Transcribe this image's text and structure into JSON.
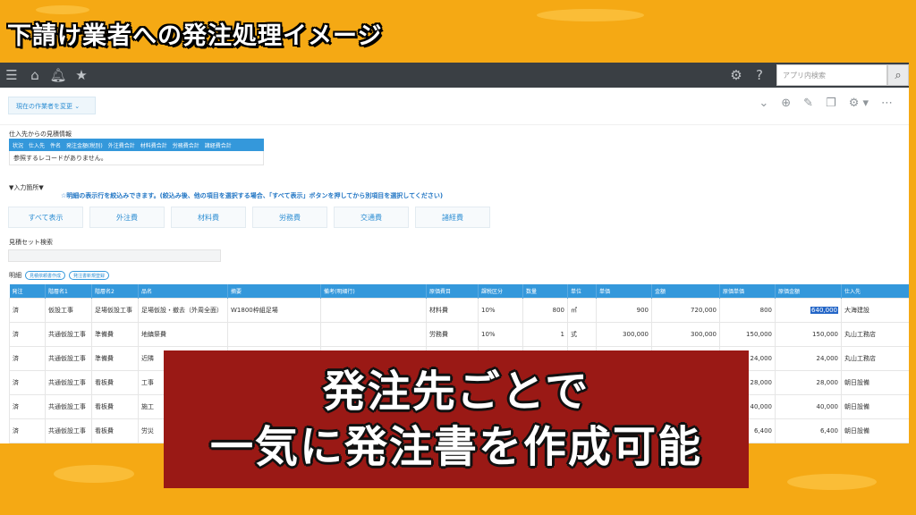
{
  "title": "下請け業者への発注処理イメージ",
  "topbar": {
    "search_placeholder": "アプリ内検索"
  },
  "worker_button": "現在の作業者を変更",
  "ref_section": {
    "label": "仕入先からの見積情報",
    "headers": [
      "状況",
      "仕入先",
      "件名",
      "発注金額(税別)",
      "外注費合計",
      "材料費合計",
      "労務費合計",
      "諸経費合計"
    ],
    "empty_message": "参照するレコードがありません。"
  },
  "input_section_label": "▼入力箇所▼",
  "note": "☆明細の表示行を絞込みできます。(絞込み後、他の項目を選択する場合、「すべて表示」ボタンを押してから別項目を選択してください)",
  "filters": [
    "すべて表示",
    "外注費",
    "材料費",
    "労務費",
    "交通費",
    "諸経費"
  ],
  "estimate_set_label": "見積セット検索",
  "detail": {
    "label": "明細",
    "buttons": [
      "見積依頼書作成",
      "発注書新規登録"
    ]
  },
  "grid": {
    "headers": [
      "発注",
      "階層名1",
      "階層名2",
      "品名",
      "摘要",
      "備考(明細行)",
      "原価費目",
      "課税区分",
      "数量",
      "単位",
      "単価",
      "金額",
      "原価単価",
      "原価金額",
      "仕入先"
    ],
    "rows": [
      [
        "済",
        "仮設工事",
        "足場仮設工事",
        "足場仮設・撤去（外周全面）",
        "W1800枠組足場",
        "",
        "材料費",
        "10%",
        "800",
        "㎡",
        "900",
        "720,000",
        "800",
        "640,000",
        "大海建設"
      ],
      [
        "済",
        "共通仮設工事",
        "準備費",
        "地鎮祭費",
        "",
        "",
        "労務費",
        "10%",
        "1",
        "式",
        "300,000",
        "300,000",
        "150,000",
        "150,000",
        "丸山工務店"
      ],
      [
        "済",
        "共通仮設工事",
        "準備費",
        "近隣",
        "",
        "",
        "",
        "",
        "",
        "",
        "",
        "",
        "24,000",
        "24,000",
        "丸山工務店"
      ],
      [
        "済",
        "共通仮設工事",
        "看板費",
        "工事",
        "",
        "",
        "",
        "",
        "",
        "",
        "",
        "",
        "28,000",
        "28,000",
        "朝日設備"
      ],
      [
        "済",
        "共通仮設工事",
        "看板費",
        "施工",
        "",
        "",
        "",
        "",
        "",
        "",
        "",
        "",
        "40,000",
        "40,000",
        "朝日設備"
      ],
      [
        "済",
        "共通仮設工事",
        "看板費",
        "労災",
        "",
        "",
        "",
        "",
        "",
        "",
        "",
        "",
        "6,400",
        "6,400",
        "朝日設備"
      ]
    ]
  },
  "caption": {
    "line1": "発注先ごとで",
    "line2": "一気に発注書を作成可能"
  },
  "colors": {
    "background": "#f5a914",
    "topbar": "#3a3f44",
    "accent_blue": "#3498db",
    "caption_red": "#9a1915"
  }
}
